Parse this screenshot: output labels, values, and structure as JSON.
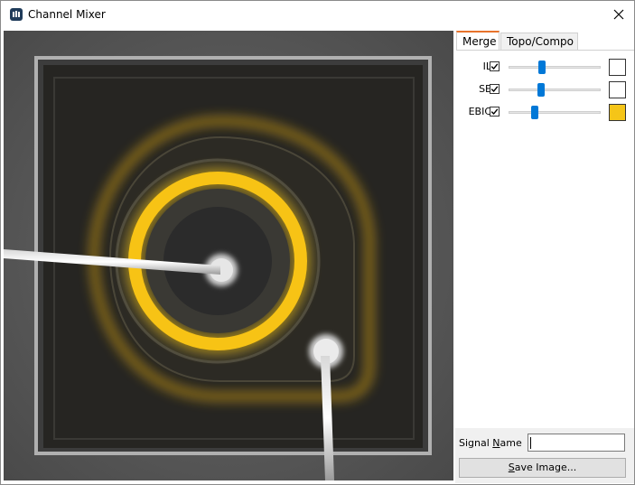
{
  "window": {
    "title": "Channel Mixer",
    "icon": "channel-mixer-app-icon",
    "close_icon": "close-icon"
  },
  "tabs": [
    {
      "label": "Merge",
      "active": true
    },
    {
      "label": "Topo/Compo",
      "active": false
    }
  ],
  "channels": [
    {
      "label": "IL",
      "checked": true,
      "slider": 0.35,
      "color": "#ffffff"
    },
    {
      "label": "SE",
      "checked": true,
      "slider": 0.34,
      "color": "#ffffff"
    },
    {
      "label": "EBIC",
      "checked": true,
      "slider": 0.27,
      "color": "#f5c518"
    }
  ],
  "signal_name": {
    "label_pre": "Signal ",
    "label_mnemonic": "N",
    "label_post": "ame",
    "value": ""
  },
  "save_button": {
    "mnemonic": "S",
    "rest": "ave Image..."
  },
  "colors": {
    "accent_tab": "#e8732c",
    "slider_thumb": "#0078d7",
    "ebic_overlay": "#f5c518"
  }
}
